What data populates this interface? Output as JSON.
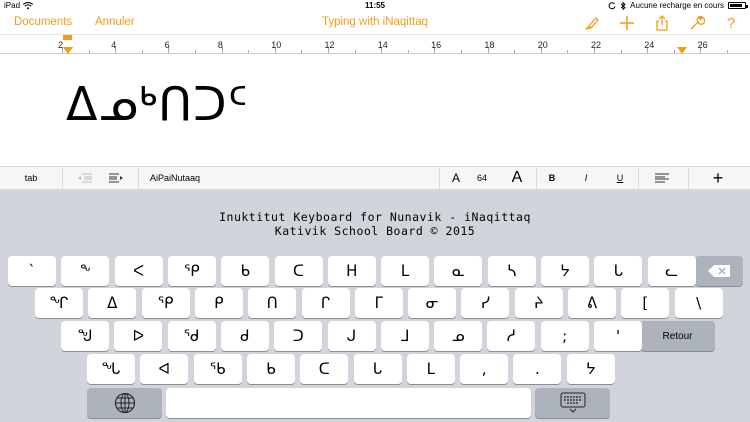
{
  "status_bar": {
    "device": "iPad",
    "time": "11:55",
    "charging_text": "Aucune recharge en cours",
    "battery_level": 0.85
  },
  "nav": {
    "documents_label": "Documents",
    "cancel_label": "Annuler",
    "title": "Typing with iNaqittaq",
    "accent": "#f29c1c",
    "icons": [
      "paintbrush-icon",
      "plus-icon",
      "share-icon",
      "wrench-icon",
      "help-icon"
    ],
    "help_glyph": "?"
  },
  "ruler": {
    "numbers": [
      "2",
      "4",
      "6",
      "8",
      "10",
      "12",
      "14",
      "16",
      "18",
      "20",
      "22",
      "24",
      "26"
    ]
  },
  "document": {
    "text": "ᐃᓄᒃᑎᑐᑦ"
  },
  "format_bar": {
    "tab_label": "tab",
    "font_name": "AiPaiNutaaq",
    "font_small": "A",
    "font_size": "64",
    "font_large": "A",
    "bold": "B",
    "italic": "I",
    "underline": "U",
    "plus": "+"
  },
  "keyboard": {
    "header_line1": "Inuktitut Keyboard for Nunavik - iNaqittaq",
    "header_line2": "Kativik School Board © 2015",
    "row1": [
      "`",
      "ᖕ",
      "ᐸ",
      "ᕿ",
      "ᑲ",
      "ᑕ",
      "ᕼ",
      "ᒪ",
      "ᓇ",
      "ᓴ",
      "ᔭ",
      "ᒐ",
      "ᓚ"
    ],
    "row2": [
      "ᖏ",
      "ᐃ",
      "ᕿ",
      "ᑭ",
      "ᑎ",
      "ᒋ",
      "ᒥ",
      "ᓂ",
      "ᓯ",
      "ᔨ",
      "ᕕ",
      "[",
      "\\"
    ],
    "row3": [
      "ᖑ",
      "ᐅ",
      "ᖁ",
      "ᑯ",
      "ᑐ",
      "ᒍ",
      "ᒧ",
      "ᓄ",
      "ᓱ",
      ";",
      "'"
    ],
    "row4": [
      "ᖓ",
      "ᐊ",
      "ᖃ",
      "ᑲ",
      "ᑕ",
      "ᒐ",
      "ᒪ",
      ",",
      ".",
      "ᔭ"
    ],
    "return_label": "Retour",
    "icons": [
      "backspace-icon",
      "globe-icon",
      "keyboard-dismiss-icon"
    ]
  }
}
